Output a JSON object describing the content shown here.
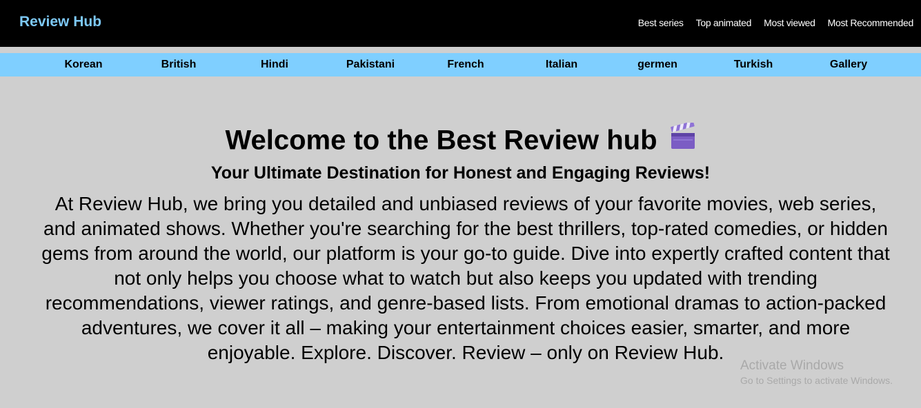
{
  "header": {
    "brand": "Review Hub",
    "links": [
      "Best series",
      "Top animated",
      "Most viewed",
      "Most Recommended"
    ]
  },
  "categories": [
    "Korean",
    "British",
    "Hindi",
    "Pakistani",
    "French",
    "Italian",
    "germen",
    "Turkish",
    "Gallery"
  ],
  "hero": {
    "title": "Welcome to the Best Review hub",
    "title_icon": "clapperboard-icon",
    "subtitle": "Your Ultimate Destination for Honest and Engaging Reviews!",
    "body": "At Review Hub, we bring you detailed and unbiased reviews of your favorite movies, web series, and animated shows. Whether you're searching for the best thrillers, top-rated comedies, or hidden gems from around the world, our platform is your go-to guide. Dive into expertly crafted content that not only helps you choose what to watch but also keeps you updated with trending recommendations, viewer ratings, and genre-based lists. From emotional dramas to action-packed adventures, we cover it all – making your entertainment choices easier, smarter, and more enjoyable. Explore. Discover. Review – only on Review Hub."
  },
  "watermark": {
    "title": "Activate Windows",
    "subtitle": "Go to Settings to activate Windows."
  },
  "colors": {
    "topbar": "#000000",
    "brand": "#7dc8f5",
    "catbar": "#7fcfff",
    "background": "#cfcfcf"
  }
}
